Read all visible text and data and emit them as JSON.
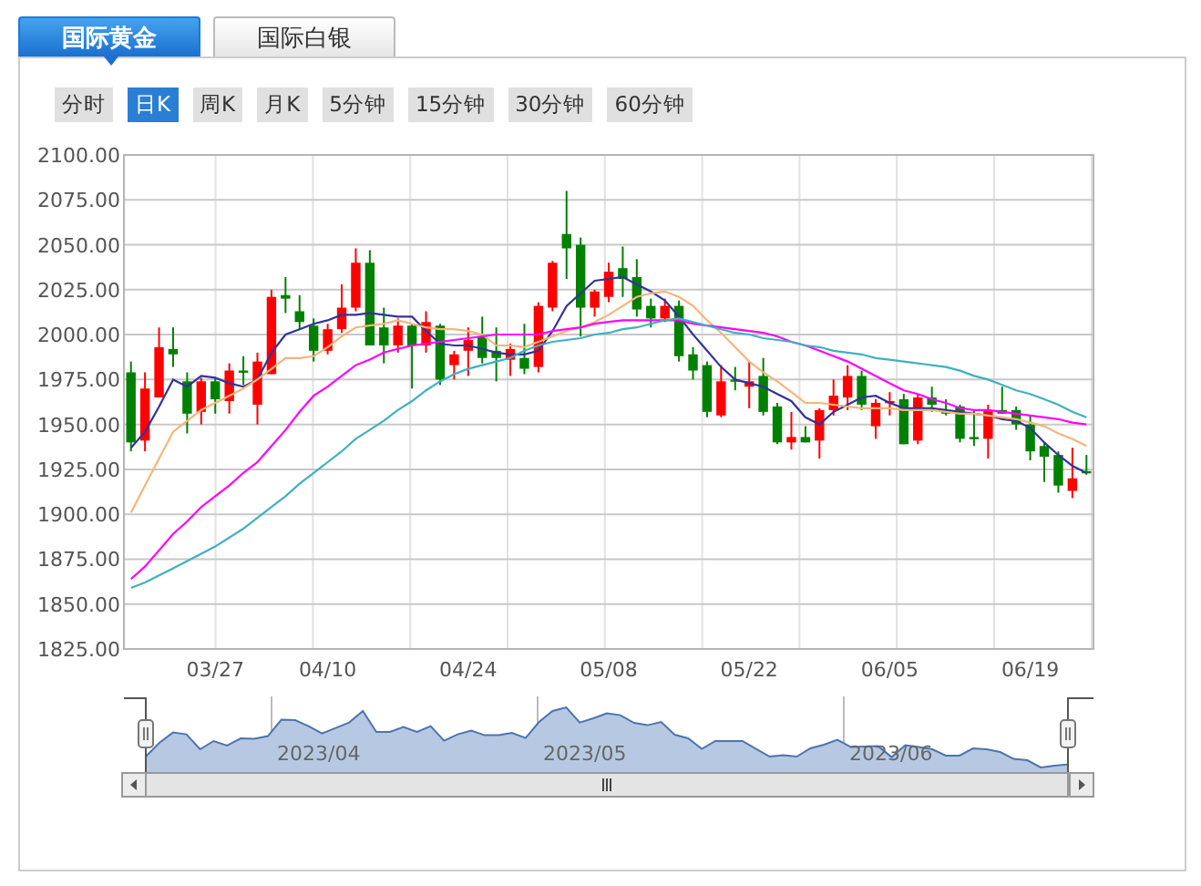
{
  "tabs": [
    {
      "label": "国际黄金",
      "selected": true
    },
    {
      "label": "国际白银",
      "selected": false
    }
  ],
  "periods": [
    {
      "label": "分时",
      "selected": false
    },
    {
      "label": "日K",
      "selected": true
    },
    {
      "label": "周K",
      "selected": false
    },
    {
      "label": "月K",
      "selected": false
    },
    {
      "label": "5分钟",
      "selected": false
    },
    {
      "label": "15分钟",
      "selected": false
    },
    {
      "label": "30分钟",
      "selected": false
    },
    {
      "label": "60分钟",
      "selected": false
    }
  ],
  "chart": {
    "chart_data": {
      "type": "candlestick",
      "ylim": [
        1825,
        2100
      ],
      "grid": true,
      "categories": [
        null,
        null,
        null,
        null,
        null,
        null,
        "03/27",
        null,
        null,
        null,
        null,
        null,
        null,
        null,
        "04/10",
        null,
        null,
        null,
        null,
        null,
        null,
        null,
        null,
        null,
        "04/24",
        null,
        null,
        null,
        null,
        null,
        null,
        null,
        null,
        null,
        "05/08",
        null,
        null,
        null,
        null,
        null,
        null,
        null,
        null,
        null,
        "05/22",
        null,
        null,
        null,
        null,
        null,
        null,
        null,
        null,
        null,
        "06/05",
        null,
        null,
        null,
        null,
        null,
        null,
        null,
        null,
        null,
        "06/19",
        null,
        null,
        null,
        null
      ],
      "yticks": [
        {
          "value": 1825,
          "label": "1825.00"
        },
        {
          "value": 1850,
          "label": "1850.00"
        },
        {
          "value": 1875,
          "label": "1875.00"
        },
        {
          "value": 1900,
          "label": "1900.00"
        },
        {
          "value": 1925,
          "label": "1925.00"
        },
        {
          "value": 1950,
          "label": "1950.00"
        },
        {
          "value": 1975,
          "label": "1975.00"
        },
        {
          "value": 2000,
          "label": "2000.00"
        },
        {
          "value": 2025,
          "label": "2025.00"
        },
        {
          "value": 2050,
          "label": "2050.00"
        },
        {
          "value": 2075,
          "label": "2075.00"
        },
        {
          "value": 2100,
          "label": "2100.00"
        }
      ],
      "ohlc": [
        [
          1979,
          1985,
          1935,
          1940
        ],
        [
          1941,
          1979,
          1935,
          1970
        ],
        [
          1965,
          2004,
          1965,
          1993
        ],
        [
          1992,
          2004,
          1982,
          1989
        ],
        [
          1974,
          1979,
          1945,
          1956
        ],
        [
          1957,
          1976,
          1950,
          1974
        ],
        [
          1974,
          1976,
          1956,
          1964
        ],
        [
          1963,
          1984,
          1956,
          1980
        ],
        [
          1980,
          1988,
          1972,
          1979
        ],
        [
          1961,
          1990,
          1950,
          1985
        ],
        [
          1978,
          2025,
          1978,
          2021
        ],
        [
          2022,
          2032,
          2012,
          2020
        ],
        [
          2013,
          2022,
          2003,
          2007
        ],
        [
          2005,
          2009,
          1985,
          1991
        ],
        [
          1991,
          2006,
          1989,
          2003
        ],
        [
          2003,
          2028,
          2001,
          2015
        ],
        [
          2015,
          2048,
          2013,
          2040
        ],
        [
          2040,
          2047,
          1994,
          1994
        ],
        [
          2004,
          2015,
          1984,
          1994
        ],
        [
          1994,
          2009,
          1990,
          2005
        ],
        [
          2005,
          2006,
          1970,
          1994
        ],
        [
          1994,
          2013,
          1990,
          2007
        ],
        [
          2005,
          2006,
          1972,
          1975
        ],
        [
          1983,
          1991,
          1975,
          1989
        ],
        [
          1991,
          2004,
          1977,
          1997
        ],
        [
          1999,
          2010,
          1984,
          1987
        ],
        [
          1991,
          2004,
          1974,
          1987
        ],
        [
          1986,
          1995,
          1977,
          1992
        ],
        [
          1987,
          2006,
          1978,
          1981
        ],
        [
          1982,
          2018,
          1979,
          2016
        ],
        [
          2015,
          2041,
          2013,
          2040
        ],
        [
          2056,
          2080,
          2031,
          2048
        ],
        [
          2050,
          2054,
          1999,
          2015
        ],
        [
          2015,
          2025,
          2010,
          2024
        ],
        [
          2021,
          2040,
          2018,
          2035
        ],
        [
          2037,
          2049,
          2021,
          2031
        ],
        [
          2032,
          2042,
          2010,
          2014
        ],
        [
          2016,
          2020,
          2004,
          2009
        ],
        [
          2009,
          2020,
          2007,
          2016
        ],
        [
          2016,
          2019,
          1985,
          1988
        ],
        [
          1989,
          1993,
          1975,
          1980
        ],
        [
          1983,
          1985,
          1954,
          1957
        ],
        [
          1955,
          1983,
          1954,
          1974
        ],
        [
          1975,
          1982,
          1969,
          1974
        ],
        [
          1971,
          1985,
          1959,
          1974
        ],
        [
          1977,
          1987,
          1955,
          1957
        ],
        [
          1960,
          1962,
          1939,
          1940
        ],
        [
          1940,
          1957,
          1936,
          1943
        ],
        [
          1943,
          1949,
          1940,
          1940
        ],
        [
          1941,
          1959,
          1931,
          1958
        ],
        [
          1958,
          1975,
          1955,
          1966
        ],
        [
          1965,
          1983,
          1958,
          1977
        ],
        [
          1977,
          1980,
          1958,
          1961
        ],
        [
          1949,
          1964,
          1942,
          1962
        ],
        [
          1962,
          1968,
          1955,
          1963
        ],
        [
          1964,
          1967,
          1939,
          1939
        ],
        [
          1941,
          1967,
          1939,
          1965
        ],
        [
          1965,
          1971,
          1957,
          1961
        ],
        [
          1958,
          1964,
          1955,
          1956
        ],
        [
          1960,
          1961,
          1940,
          1942
        ],
        [
          1943,
          1958,
          1938,
          1942
        ],
        [
          1942,
          1961,
          1931,
          1958
        ],
        [
          1958,
          1971,
          1956,
          1956
        ],
        [
          1958,
          1960,
          1947,
          1950
        ],
        [
          1950,
          1955,
          1930,
          1935
        ],
        [
          1938,
          1940,
          1918,
          1932
        ],
        [
          1933,
          1935,
          1912,
          1916
        ],
        [
          1913,
          1937,
          1909,
          1920
        ],
        [
          1924,
          1933,
          1922,
          1923
        ]
      ],
      "series": [
        {
          "type": "line",
          "color": "#333399",
          "values": [
            1937,
            1946,
            1960,
            1975,
            1971,
            1977,
            1976,
            1973,
            1971,
            1975,
            1990,
            2000,
            2003,
            2006,
            2008,
            2011,
            2011,
            2012,
            2011,
            2010,
            2010,
            2002,
            1995,
            1994,
            1994,
            1992,
            1990,
            1989,
            1989,
            1991,
            2002,
            2016,
            2023,
            2030,
            2031,
            2032,
            2028,
            2024,
            2019,
            2010,
            2000,
            1991,
            1982,
            1975,
            1973,
            1971,
            1967,
            1963,
            1954,
            1950,
            1957,
            1961,
            1965,
            1966,
            1962,
            1959,
            1959,
            1959,
            1958,
            1957,
            1956,
            1955,
            1953,
            1952,
            1948,
            1940,
            1933,
            1927,
            1923
          ]
        },
        {
          "type": "line",
          "color": "#f5b57a",
          "values": [
            1901,
            1916,
            1931,
            1946,
            1952,
            1958,
            1962,
            1966,
            1970,
            1975,
            1981,
            1987,
            1987,
            1988,
            1993,
            1999,
            2004,
            2005,
            2006,
            2008,
            2006,
            2004,
            2003,
            2003,
            2002,
            2000,
            1994,
            1994,
            1993,
            1996,
            1999,
            2002,
            2004,
            2007,
            2011,
            2016,
            2021,
            2023,
            2024,
            2021,
            2016,
            2008,
            2001,
            1993,
            1985,
            1979,
            1974,
            1968,
            1962,
            1962,
            1961,
            1960,
            1959,
            1959,
            1959,
            1958,
            1958,
            1958,
            1957,
            1956,
            1956,
            1955,
            1954,
            1953,
            1951,
            1949,
            1945,
            1942,
            1938
          ]
        },
        {
          "type": "line",
          "color": "#ff00ff",
          "values": [
            1864,
            1871,
            1880,
            1889,
            1896,
            1904,
            1910,
            1916,
            1923,
            1929,
            1938,
            1947,
            1957,
            1966,
            1971,
            1977,
            1983,
            1986,
            1990,
            1992,
            1994,
            1995,
            1996,
            1997,
            1998,
            1999,
            2000,
            2000,
            2000,
            2000,
            2002,
            2003,
            2004,
            2006,
            2007,
            2008,
            2008,
            2008,
            2008,
            2008,
            2006,
            2005,
            2004,
            2003,
            2002,
            2001,
            1999,
            1996,
            1994,
            1991,
            1988,
            1985,
            1981,
            1977,
            1973,
            1969,
            1967,
            1964,
            1962,
            1959,
            1958,
            1958,
            1957,
            1956,
            1955,
            1954,
            1953,
            1951,
            1950
          ]
        },
        {
          "type": "line",
          "color": "#40b0c0",
          "values": [
            1859,
            1862,
            1866,
            1870,
            1874,
            1878,
            1882,
            1887,
            1892,
            1898,
            1904,
            1910,
            1917,
            1923,
            1929,
            1935,
            1942,
            1947,
            1952,
            1958,
            1963,
            1969,
            1974,
            1978,
            1981,
            1983,
            1985,
            1987,
            1991,
            1994,
            1996,
            1997,
            1998,
            2000,
            2001,
            2003,
            2004,
            2006,
            2008,
            2009,
            2007,
            2005,
            2003,
            2001,
            2000,
            1998,
            1997,
            1996,
            1994,
            1993,
            1991,
            1990,
            1989,
            1987,
            1986,
            1985,
            1984,
            1983,
            1982,
            1980,
            1977,
            1975,
            1972,
            1969,
            1967,
            1964,
            1961,
            1957,
            1954
          ]
        }
      ]
    }
  },
  "navigator": {
    "labels": [
      "2023/04",
      "2023/05",
      "2023/06"
    ]
  }
}
